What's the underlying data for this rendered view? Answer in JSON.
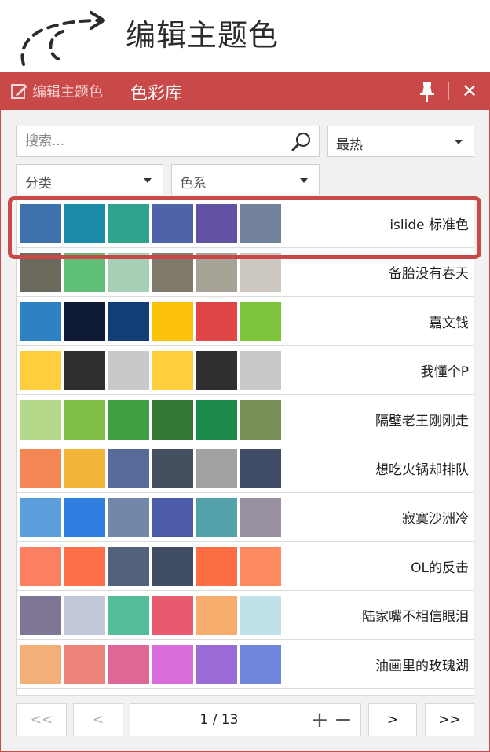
{
  "annotation": {
    "title": "编辑主题色"
  },
  "titlebar": {
    "edit_label": "编辑主题色",
    "title": "色彩库",
    "close_glyph": "✕"
  },
  "search": {
    "placeholder": "搜索..."
  },
  "filters": {
    "sort": "最热",
    "category": "分类",
    "color_family": "色系"
  },
  "palettes": [
    {
      "name": "islide 标准色",
      "colors": [
        "#3e72ad",
        "#1a8ca7",
        "#2fa28b",
        "#4f63a8",
        "#6352a4",
        "#72829a"
      ]
    },
    {
      "name": "备胎没有春天",
      "colors": [
        "#6c6a5c",
        "#5fbf76",
        "#a6d0b6",
        "#807a6b",
        "#a7a397",
        "#cdc8c1"
      ]
    },
    {
      "name": "嘉文钱",
      "colors": [
        "#2d82c4",
        "#0e1a33",
        "#123d77",
        "#fcc20a",
        "#e04548",
        "#7dc43b"
      ]
    },
    {
      "name": "我懂个P",
      "colors": [
        "#fdcf3d",
        "#2f2f32",
        "#c9c9cb",
        "#fdcf3d",
        "#2f2f32",
        "#c9c9cb"
      ]
    },
    {
      "name": "隔壁老王刚刚走",
      "colors": [
        "#b5d98a",
        "#7fbe45",
        "#3fa042",
        "#327833",
        "#1c8a4a",
        "#7a8f57"
      ]
    },
    {
      "name": "想吃火锅却排队",
      "colors": [
        "#f58656",
        "#f1b63a",
        "#576a98",
        "#444f5f",
        "#a2a2a2",
        "#404b66"
      ]
    },
    {
      "name": "寂寞沙洲冷",
      "colors": [
        "#5c9edb",
        "#2e7edf",
        "#7387aa",
        "#4c5ca8",
        "#53a2a9",
        "#9991a2"
      ]
    },
    {
      "name": "OL的反击",
      "colors": [
        "#fc7e63",
        "#fe6e48",
        "#53617b",
        "#3f4c63",
        "#fd6e45",
        "#fe8a5f"
      ]
    },
    {
      "name": "陆家嘴不相信眼泪",
      "colors": [
        "#7e7694",
        "#c2c8d7",
        "#52bd98",
        "#e85b6f",
        "#f6ad6e",
        "#c1e1e8"
      ]
    },
    {
      "name": "油画里的玫瑰湖",
      "colors": [
        "#f2af78",
        "#ed847a",
        "#df6795",
        "#d96bdb",
        "#9b6cd7",
        "#6f86dd"
      ]
    }
  ],
  "pagination": {
    "first": "<<",
    "prev": "<",
    "page_text": "1 / 13",
    "plus": "+",
    "minus": "−",
    "next": ">",
    "last": ">>"
  },
  "colors": {
    "accent": "#c94948",
    "panel_bg": "#f1f1f1"
  }
}
